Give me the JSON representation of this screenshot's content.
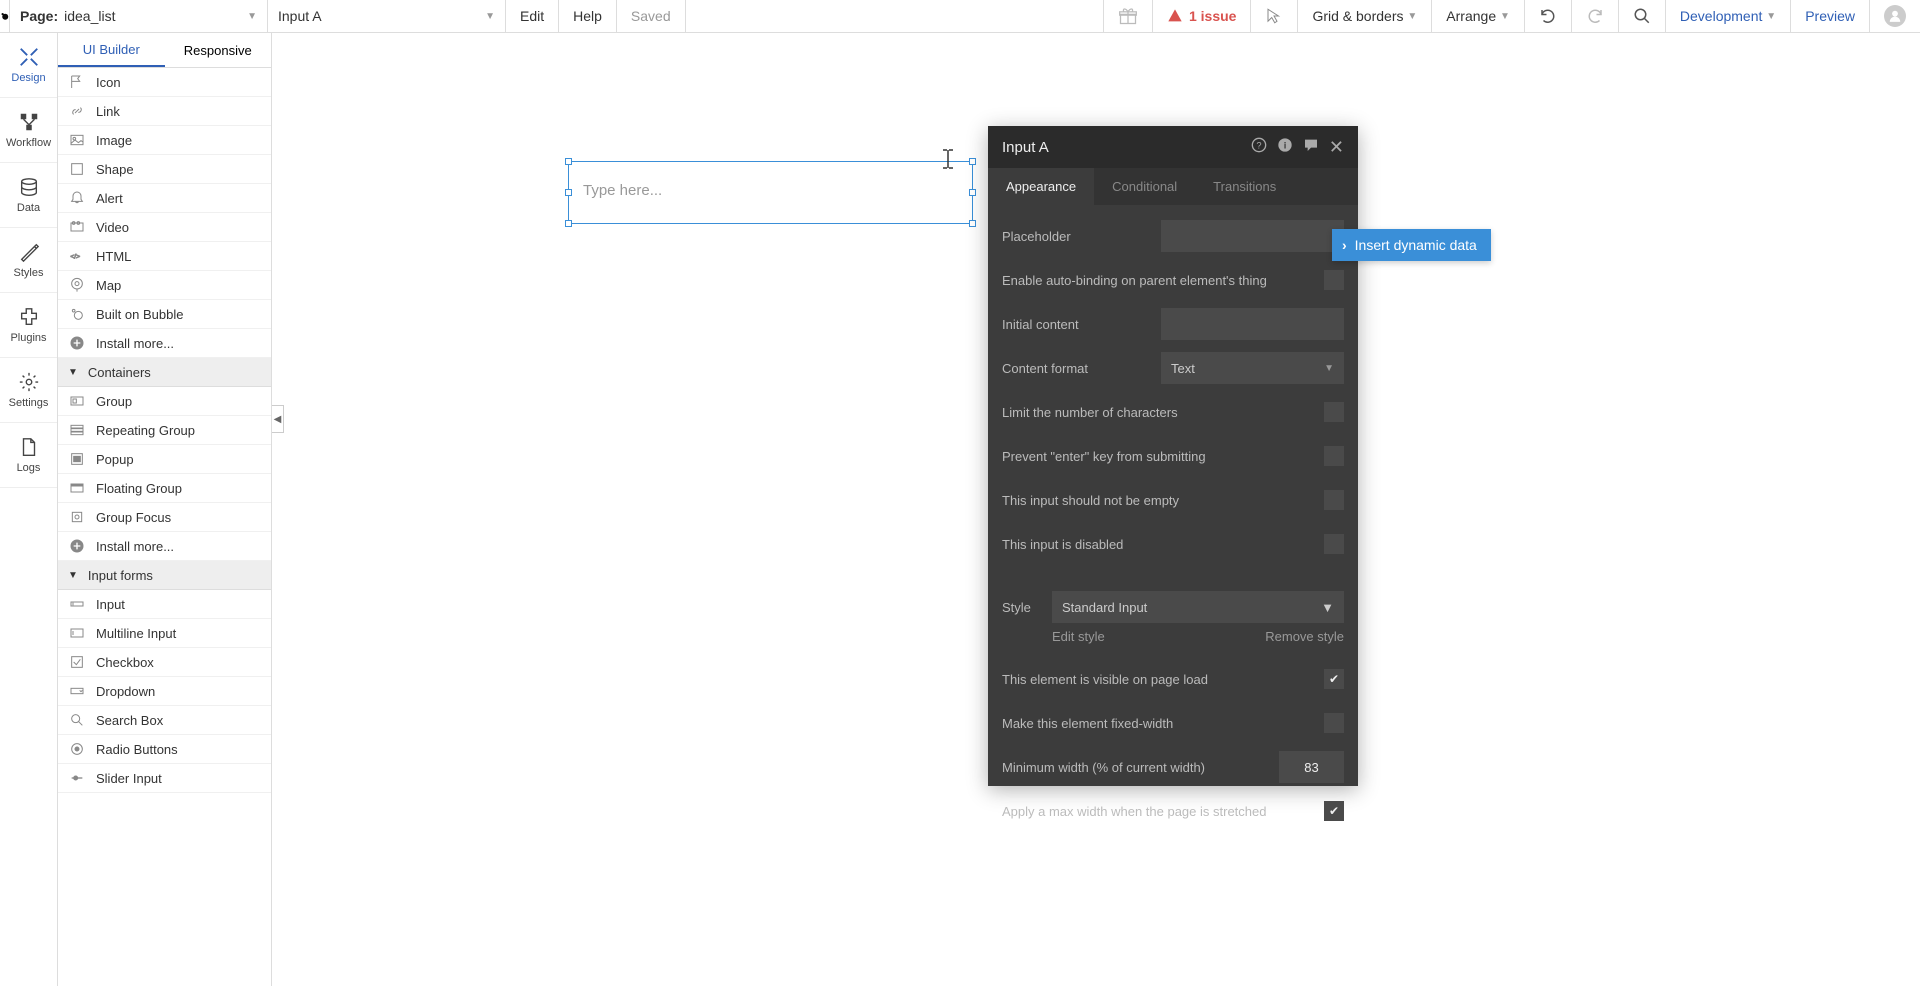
{
  "topbar": {
    "page_label": "Page:",
    "page_value": "idea_list",
    "element_value": "Input A",
    "menu": {
      "edit": "Edit",
      "help": "Help",
      "saved": "Saved"
    },
    "issue": "1 issue",
    "grid": "Grid & borders",
    "arrange": "Arrange",
    "dev": "Development",
    "preview": "Preview"
  },
  "rail": {
    "design": "Design",
    "workflow": "Workflow",
    "data": "Data",
    "styles": "Styles",
    "plugins": "Plugins",
    "settings": "Settings",
    "logs": "Logs"
  },
  "palette": {
    "tab_ui": "UI Builder",
    "tab_resp": "Responsive",
    "elements": [
      {
        "icon": "flag",
        "label": "Icon"
      },
      {
        "icon": "link",
        "label": "Link"
      },
      {
        "icon": "image",
        "label": "Image"
      },
      {
        "icon": "shape",
        "label": "Shape"
      },
      {
        "icon": "alert",
        "label": "Alert"
      },
      {
        "icon": "video",
        "label": "Video"
      },
      {
        "icon": "html",
        "label": "HTML"
      },
      {
        "icon": "map",
        "label": "Map"
      },
      {
        "icon": "bubble",
        "label": "Built on Bubble"
      },
      {
        "icon": "plus",
        "label": "Install more..."
      }
    ],
    "section_containers": "Containers",
    "containers": [
      {
        "icon": "group",
        "label": "Group"
      },
      {
        "icon": "rgroup",
        "label": "Repeating Group"
      },
      {
        "icon": "popup",
        "label": "Popup"
      },
      {
        "icon": "fgroup",
        "label": "Floating Group"
      },
      {
        "icon": "gfocus",
        "label": "Group Focus"
      },
      {
        "icon": "plus",
        "label": "Install more..."
      }
    ],
    "section_inputs": "Input forms",
    "inputs": [
      {
        "icon": "input",
        "label": "Input"
      },
      {
        "icon": "minput",
        "label": "Multiline Input"
      },
      {
        "icon": "check",
        "label": "Checkbox"
      },
      {
        "icon": "drop",
        "label": "Dropdown"
      },
      {
        "icon": "search",
        "label": "Search Box"
      },
      {
        "icon": "radio",
        "label": "Radio Buttons"
      },
      {
        "icon": "slider",
        "label": "Slider Input"
      }
    ]
  },
  "canvas": {
    "input_placeholder": "Type here..."
  },
  "prop": {
    "title": "Input A",
    "tabs": {
      "appearance": "Appearance",
      "conditional": "Conditional",
      "transitions": "Transitions"
    },
    "fields": {
      "placeholder": "Placeholder",
      "autobind": "Enable auto-binding on parent element's thing",
      "initial": "Initial content",
      "format": "Content format",
      "format_value": "Text",
      "limit": "Limit the number of characters",
      "prevent_enter": "Prevent \"enter\" key from submitting",
      "not_empty": "This input should not be empty",
      "disabled": "This input is disabled",
      "style": "Style",
      "style_value": "Standard Input",
      "edit_style": "Edit style",
      "remove_style": "Remove style",
      "visible": "This element is visible on page load",
      "fixed_width": "Make this element fixed-width",
      "min_width": "Minimum width (% of current width)",
      "min_width_value": "83",
      "max_width": "Apply a max width when the page is stretched"
    }
  },
  "dyn_tip": "Insert dynamic data"
}
